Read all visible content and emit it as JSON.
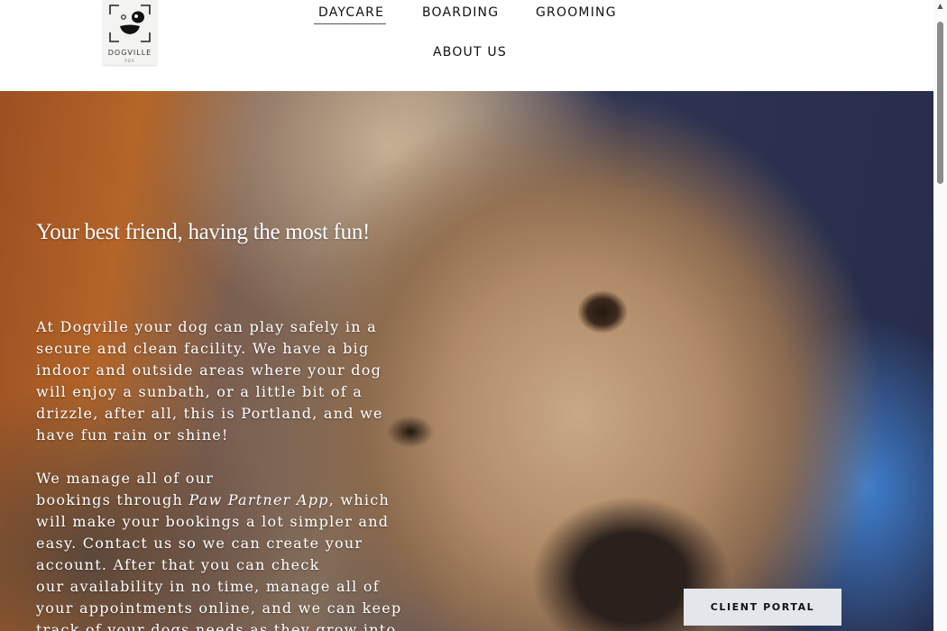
{
  "header": {
    "logo": {
      "name": "DOGVILLE",
      "tagline": "PDX"
    },
    "nav": {
      "daycare": "DAYCARE",
      "boarding": "BOARDING",
      "grooming": "GROOMING",
      "about": "ABOUT US"
    },
    "active_nav": "DAYCARE"
  },
  "hero": {
    "title": "Your best friend, having the most fun!",
    "paragraph1_lines": [
      "At Dogville your dog can play safely in a",
      "secure and clean facility. We have a big",
      "indoor and outside areas where your dog",
      "will enjoy a sunbath, or a little bit of a",
      "drizzle, after all, this is Portland, and we",
      "have fun rain or shine!"
    ],
    "paragraph2": {
      "line1": "We manage all of our",
      "line2_before": "bookings through ",
      "app_name": "Paw Partner App",
      "line2_after": ", which",
      "lines_rest": [
        "will make your bookings a lot simpler and",
        "easy. Contact us so we can create your",
        "account. After that you can check",
        "our availability in no time, manage all of",
        "your appointments online, and we can keep",
        "track of your dogs needs as they grow into"
      ]
    },
    "client_portal_label": "CLIENT PORTAL"
  },
  "colors": {
    "header_bg": "#ffffff",
    "nav_text": "#111111",
    "hero_text": "#ffffff",
    "button_bg": "#e3e6ea"
  },
  "icons": [
    "dog-face-logo-icon",
    "scroll-up-arrow-icon"
  ]
}
